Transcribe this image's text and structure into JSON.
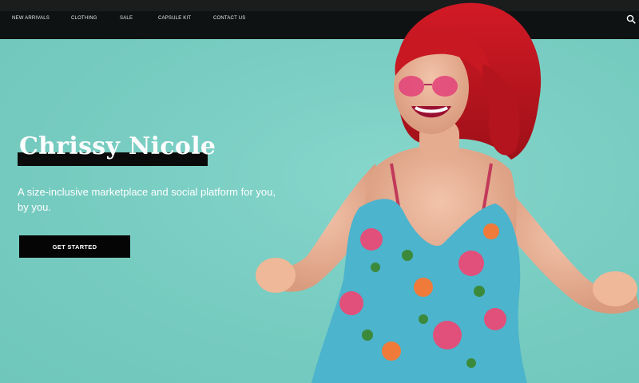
{
  "nav": {
    "items": [
      {
        "label": "NEW ARRIVALS"
      },
      {
        "label": "CLOTHING"
      },
      {
        "label": "SALE"
      },
      {
        "label": "CAPSULE KIT"
      },
      {
        "label": "CONTACT US"
      }
    ],
    "search_icon": "search-icon"
  },
  "hero": {
    "title": "Chrissy Nicole",
    "subtitle": "A size-inclusive marketplace and social platform for you, by you.",
    "cta_label": "GET STARTED",
    "image": "hero-model-photo"
  },
  "colors": {
    "background": "#78ccc1",
    "navbar": "#0f1212",
    "button": "#050505",
    "text": "#ffffff"
  }
}
